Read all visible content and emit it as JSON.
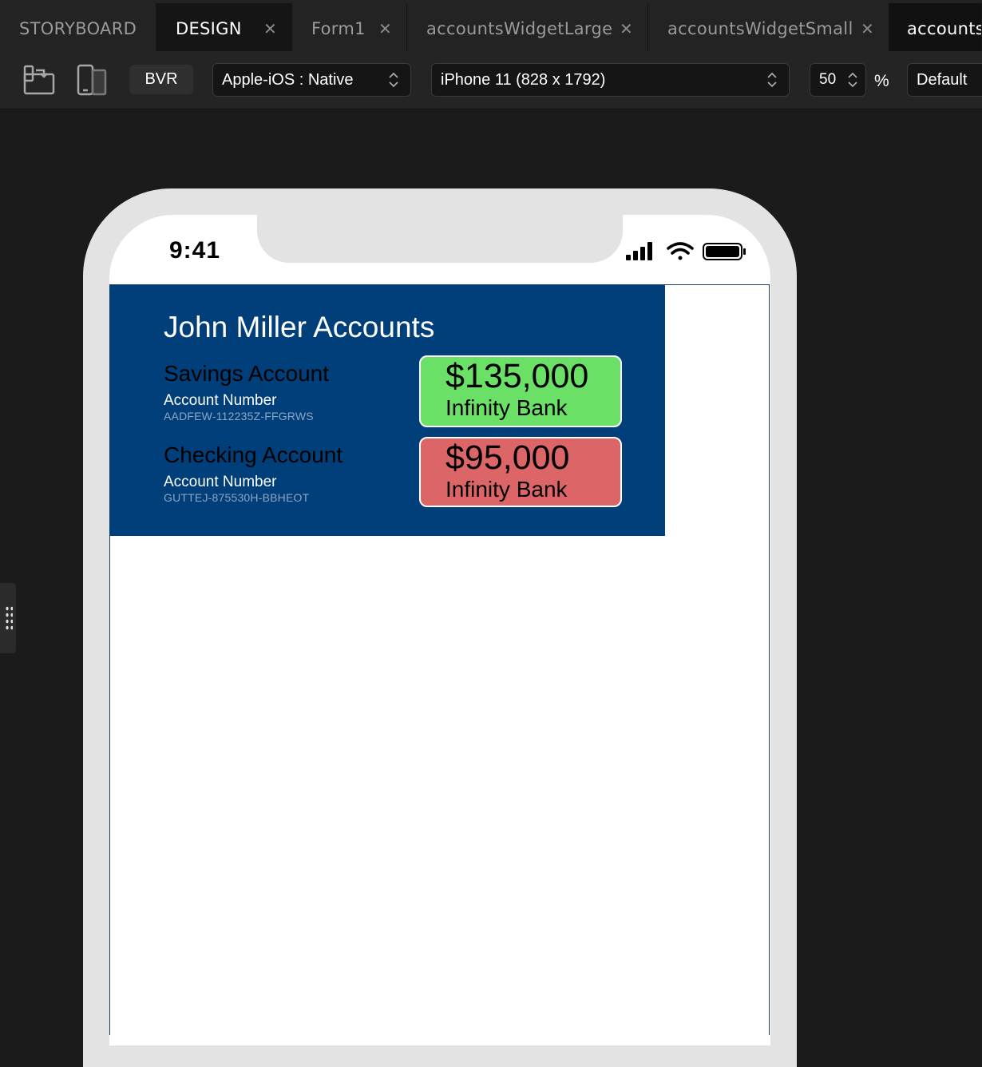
{
  "tabs": [
    {
      "label": "STORYBOARD",
      "closable": false,
      "active": false
    },
    {
      "label": "DESIGN",
      "closable": true,
      "active": true
    },
    {
      "label": "Form1",
      "closable": true,
      "active": false
    },
    {
      "label": "accountsWidgetLarge",
      "closable": true,
      "active": false
    },
    {
      "label": "accountsWidgetSmall",
      "closable": true,
      "active": false
    },
    {
      "label": "accountsW",
      "closable": false,
      "active": true
    }
  ],
  "toolbar": {
    "rotate_icon": "rotate-device-icon",
    "device_icon": "device-icon",
    "bvr_label": "BVR",
    "platform": "Apple-iOS : Native",
    "device": "iPhone 11 (828 x 1792)",
    "zoom": "50",
    "zoom_unit": "%",
    "theme": "Default"
  },
  "status_bar": {
    "time": "9:41",
    "icons": [
      "cellular-signal-icon",
      "wifi-icon",
      "battery-icon"
    ]
  },
  "widget": {
    "title": "John Miller Accounts",
    "accounts": [
      {
        "name": "Savings Account",
        "number_label": "Account Number",
        "number": "AADFEW-112235Z-FFGRWS",
        "balance": "$135,000",
        "bank": "Infinity Bank",
        "card_color": "#6be067"
      },
      {
        "name": "Checking Account",
        "number_label": "Account Number",
        "number": "GUTTEJ-875530H-BBHEOT",
        "balance": "$95,000",
        "bank": "Infinity Bank",
        "card_color": "#dc6667"
      }
    ],
    "background_color": "#003f79"
  }
}
